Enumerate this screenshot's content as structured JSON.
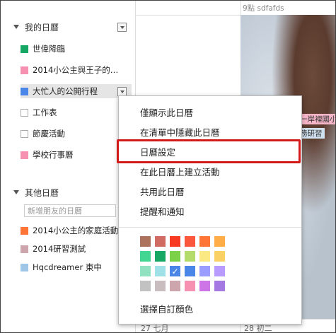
{
  "header": {
    "top_right_event": "9點 sdfafds"
  },
  "sidebar": {
    "my_calendars_title": "我的日曆",
    "my_calendars": [
      {
        "label": "世偉降臨",
        "color": "#16a765",
        "filled": true
      },
      {
        "label": "2014小公主與王子的…",
        "color": "#f691b2",
        "filled": true
      },
      {
        "label": "大忙人的公開行程",
        "color": "#4986e7",
        "filled": true,
        "selected": true
      },
      {
        "label": "工作表",
        "color": "#aaaaaa",
        "filled": false
      },
      {
        "label": "節慶活動",
        "color": "#aaaaaa",
        "filled": false
      },
      {
        "label": "學校行事曆",
        "color": "#f691b2",
        "filled": true
      }
    ],
    "other_calendars_title": "其他日曆",
    "add_friend_placeholder": "新增朋友的日曆",
    "other_calendars": [
      {
        "label": "2014小公主的家庭活動",
        "color": "#ff7537",
        "filled": true
      },
      {
        "label": "2014研習測試",
        "color": "#cca6ac",
        "filled": true
      },
      {
        "label": "Hqcdreamer 東中",
        "color": "#9fc6e7",
        "filled": true
      }
    ]
  },
  "grid": {
    "event_chip_1": "一岸裡國小",
    "event_chip_2": "務研習",
    "event_chip_1_color": "#f6b6c8",
    "event_chip_2_color": "#cfe0ef",
    "bottom_left_day": "27 七月",
    "bottom_right_day": "28 初二"
  },
  "menu": {
    "items": [
      "僅顯示此日曆",
      "在清單中隱藏此日曆",
      "日曆設定",
      "在此日曆上建立活動",
      "共用此日曆",
      "提醒和通知"
    ],
    "highlighted_item": "日曆設定",
    "highlight_color": "#d31a1a",
    "custom_color_label": "選擇自訂顏色",
    "selected_color": "#9fc6e7",
    "palette": [
      [
        "#ac725e",
        "#d06b64",
        "#f83a22",
        "#fa573c",
        "#ff7537",
        "#ffad46"
      ],
      [
        "#42d692",
        "#16a765",
        "#7bd148",
        "#b3dc6c",
        "#fbe983",
        "#fad165"
      ],
      [
        "#92e1c0",
        "#9fe1e7",
        "#9fc6e7",
        "#4986e7",
        "#9a9cff",
        "#b99aff"
      ],
      [
        "#c2c2c2",
        "#cabdbf",
        "#cca6ac",
        "#f691b2",
        "#cd74e6",
        "#a47ae2"
      ]
    ]
  }
}
